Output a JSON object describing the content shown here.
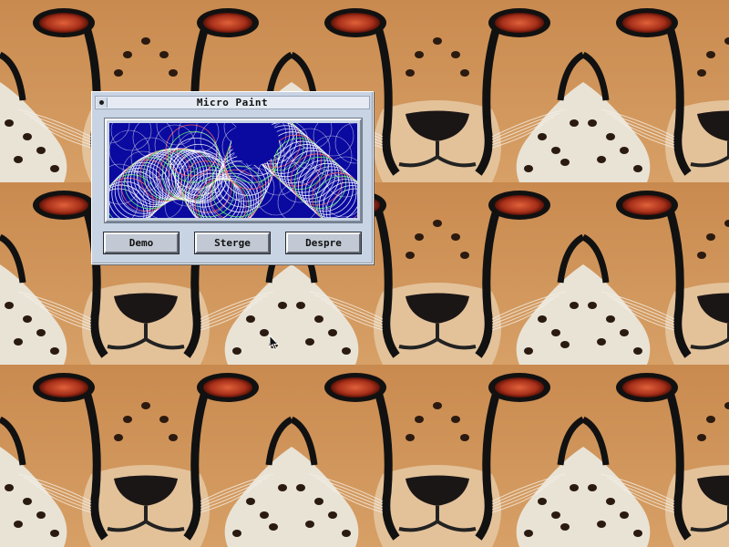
{
  "window": {
    "title": "Micro Paint"
  },
  "buttons": {
    "demo": "Demo",
    "sterge": "Sterge",
    "despre": "Despre"
  },
  "colors": {
    "window_bg": "#c8d3e3",
    "canvas_bg": "#0a0aa0",
    "desktop_fur": "#c8894e"
  },
  "icons": {
    "close": "close-box-icon",
    "cursor": "mouse-pointer-icon",
    "wallpaper": "cheetah-face-wallpaper"
  }
}
